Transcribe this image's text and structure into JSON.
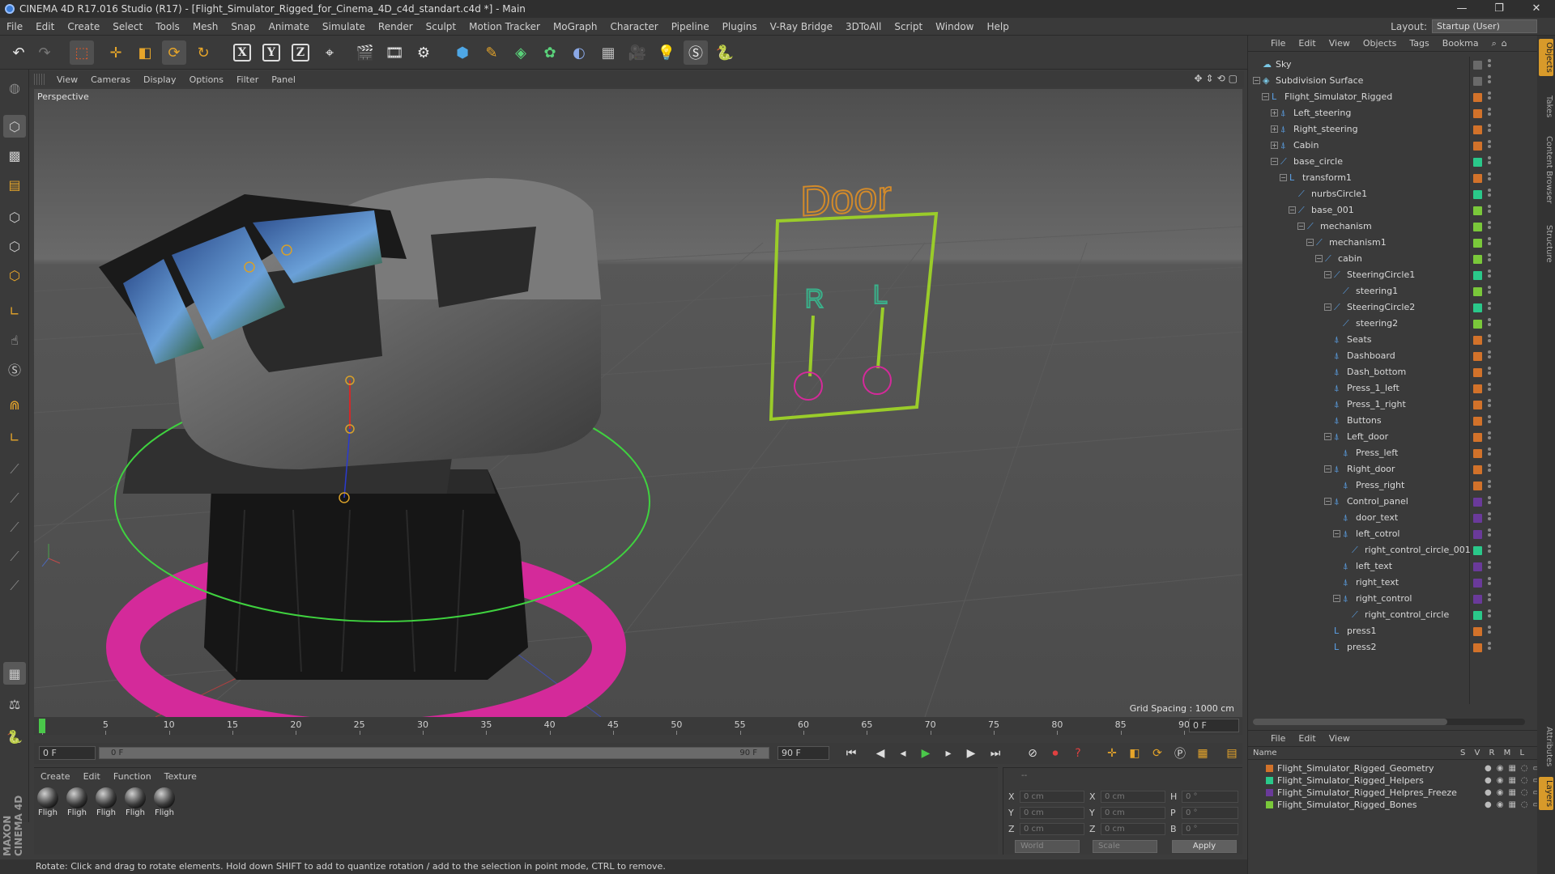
{
  "window": {
    "title": "CINEMA 4D R17.016 Studio (R17) - [Flight_Simulator_Rigged_for_Cinema_4D_c4d_standart.c4d *] - Main",
    "controls": [
      "—",
      "❐",
      "✕"
    ]
  },
  "menubar": {
    "items": [
      "File",
      "Edit",
      "Create",
      "Select",
      "Tools",
      "Mesh",
      "Snap",
      "Animate",
      "Simulate",
      "Render",
      "Sculpt",
      "Motion Tracker",
      "MoGraph",
      "Character",
      "Pipeline",
      "Plugins",
      "V-Ray Bridge",
      "3DToAll",
      "Script",
      "Window",
      "Help"
    ],
    "layout_label": "Layout:",
    "layout_value": "Startup (User)"
  },
  "toolbar": {
    "icons": [
      "undo-icon",
      "redo-icon",
      "live-selection-icon",
      "move-icon",
      "scale-icon",
      "rotate-icon",
      "recent-tool-icon",
      "x-axis-icon",
      "y-axis-icon",
      "z-axis-icon",
      "world-coordinate-icon",
      "render-view-icon",
      "render-picture-viewer-icon",
      "edit-render-settings-icon",
      "cube-icon",
      "pen-icon",
      "subdivision-icon",
      "cloner-icon",
      "deformer-icon",
      "floor-icon",
      "camera-icon",
      "light-icon",
      "python-generator-icon",
      "python-icon"
    ],
    "axis_labels": [
      "X",
      "Y",
      "Z"
    ]
  },
  "left_tools": [
    "make-editable-icon",
    "model-mode-icon",
    "texture-mode-icon",
    "workplane-icon",
    "points-mode-icon",
    "edges-mode-icon",
    "polygons-mode-icon",
    "axis-mode-icon",
    "tweak-icon",
    "solo-icon",
    "enable-snap-icon",
    "locked-workplane-icon",
    "planar-workplane-icon",
    "x-workplane-icon",
    "y-workplane-icon",
    "z-workplane-icon",
    "axis-workplane-icon",
    "viewport-solo-icon",
    "weight-icon",
    "python-icon"
  ],
  "viewport": {
    "menu": [
      "View",
      "Cameras",
      "Display",
      "Options",
      "Filter",
      "Panel"
    ],
    "label": "Perspective",
    "grid_spacing": "Grid Spacing : 1000 cm",
    "door_panel": {
      "title": "Door",
      "left_letter": "R",
      "right_letter": "L"
    },
    "colors": {
      "background": "#5a5a5a",
      "floor": "#4d4d4d",
      "green_ring": "#3fd23f",
      "pink_ring": "#d42a9a",
      "panel_frame": "#9acc2a",
      "door_text": "#d28a2a",
      "control_green": "#3ab08a"
    }
  },
  "timeline": {
    "ticks": [
      "0",
      "5",
      "10",
      "15",
      "20",
      "25",
      "30",
      "35",
      "40",
      "45",
      "50",
      "55",
      "60",
      "65",
      "70",
      "75",
      "80",
      "85",
      "90"
    ],
    "current_frame": "0 F"
  },
  "transport": {
    "start_field": "0 F",
    "slider_left": "0 F",
    "slider_right": "90 F",
    "end_field": "90 F"
  },
  "material_panel": {
    "menu": [
      "Create",
      "Edit",
      "Function",
      "Texture"
    ],
    "materials": [
      "Fligh",
      "Fligh",
      "Fligh",
      "Fligh",
      "Fligh"
    ]
  },
  "coordinates": {
    "header": "--",
    "rows": [
      {
        "a": "X",
        "av": "0 cm",
        "b": "X",
        "bv": "0 cm",
        "c": "H",
        "cv": "0 °"
      },
      {
        "a": "Y",
        "av": "0 cm",
        "b": "Y",
        "bv": "0 cm",
        "c": "P",
        "cv": "0 °"
      },
      {
        "a": "Z",
        "av": "0 cm",
        "b": "Z",
        "bv": "0 cm",
        "c": "B",
        "cv": "0 °"
      }
    ],
    "mode1": "World",
    "mode2": "Scale",
    "apply": "Apply"
  },
  "status": "Rotate: Click and drag to rotate elements. Hold down SHIFT to add to quantize rotation / add to the selection in point mode, CTRL to remove.",
  "maxon": "MAXON CINEMA 4D",
  "object_manager": {
    "menu": [
      "File",
      "Edit",
      "View",
      "Objects",
      "Tags",
      "Bookma"
    ],
    "objects": [
      {
        "name": "Sky",
        "depth": 0,
        "color": "#6a6a6a",
        "tree": ""
      },
      {
        "name": "Subdivision Surface",
        "depth": 0,
        "color": "#6a6a6a",
        "tree": "-"
      },
      {
        "name": "Flight_Simulator_Rigged",
        "depth": 1,
        "color": "#d2722a",
        "tree": "-"
      },
      {
        "name": "Left_steering",
        "depth": 2,
        "color": "#d2722a",
        "tree": "+"
      },
      {
        "name": "Right_steering",
        "depth": 2,
        "color": "#d2722a",
        "tree": "+"
      },
      {
        "name": "Cabin",
        "depth": 2,
        "color": "#d2722a",
        "tree": "+"
      },
      {
        "name": "base_circle",
        "depth": 2,
        "color": "#2ac88a",
        "tree": "-"
      },
      {
        "name": "transform1",
        "depth": 3,
        "color": "#d2722a",
        "tree": "-"
      },
      {
        "name": "nurbsCircle1",
        "depth": 4,
        "color": "#2ac88a",
        "tree": ""
      },
      {
        "name": "base_001",
        "depth": 4,
        "color": "#7ac83a",
        "tree": "-"
      },
      {
        "name": "mechanism",
        "depth": 5,
        "color": "#7ac83a",
        "tree": "-"
      },
      {
        "name": "mechanism1",
        "depth": 6,
        "color": "#7ac83a",
        "tree": "-"
      },
      {
        "name": "cabin",
        "depth": 7,
        "color": "#7ac83a",
        "tree": "-"
      },
      {
        "name": "SteeringCircle1",
        "depth": 8,
        "color": "#2ac88a",
        "tree": "-"
      },
      {
        "name": "steering1",
        "depth": 9,
        "color": "#7ac83a",
        "tree": ""
      },
      {
        "name": "SteeringCircle2",
        "depth": 8,
        "color": "#2ac88a",
        "tree": "-"
      },
      {
        "name": "steering2",
        "depth": 9,
        "color": "#7ac83a",
        "tree": ""
      },
      {
        "name": "Seats",
        "depth": 8,
        "color": "#d2722a",
        "tree": ""
      },
      {
        "name": "Dashboard",
        "depth": 8,
        "color": "#d2722a",
        "tree": ""
      },
      {
        "name": "Dash_bottom",
        "depth": 8,
        "color": "#d2722a",
        "tree": ""
      },
      {
        "name": "Press_1_left",
        "depth": 8,
        "color": "#d2722a",
        "tree": ""
      },
      {
        "name": "Press_1_right",
        "depth": 8,
        "color": "#d2722a",
        "tree": ""
      },
      {
        "name": "Buttons",
        "depth": 8,
        "color": "#d2722a",
        "tree": ""
      },
      {
        "name": "Left_door",
        "depth": 8,
        "color": "#d2722a",
        "tree": "-"
      },
      {
        "name": "Press_left",
        "depth": 9,
        "color": "#d2722a",
        "tree": ""
      },
      {
        "name": "Right_door",
        "depth": 8,
        "color": "#d2722a",
        "tree": "-"
      },
      {
        "name": "Press_right",
        "depth": 9,
        "color": "#d2722a",
        "tree": ""
      },
      {
        "name": "Control_panel",
        "depth": 8,
        "color": "#6a3a9a",
        "tree": "-"
      },
      {
        "name": "door_text",
        "depth": 9,
        "color": "#6a3a9a",
        "tree": ""
      },
      {
        "name": "left_cotrol",
        "depth": 9,
        "color": "#6a3a9a",
        "tree": "-"
      },
      {
        "name": "right_control_circle_001",
        "depth": 10,
        "color": "#2ac88a",
        "tree": ""
      },
      {
        "name": "left_text",
        "depth": 9,
        "color": "#6a3a9a",
        "tree": ""
      },
      {
        "name": "right_text",
        "depth": 9,
        "color": "#6a3a9a",
        "tree": ""
      },
      {
        "name": "right_control",
        "depth": 9,
        "color": "#6a3a9a",
        "tree": "-"
      },
      {
        "name": "right_control_circle",
        "depth": 10,
        "color": "#2ac88a",
        "tree": ""
      },
      {
        "name": "press1",
        "depth": 8,
        "color": "#d2722a",
        "tree": ""
      },
      {
        "name": "press2",
        "depth": 8,
        "color": "#d2722a",
        "tree": ""
      }
    ]
  },
  "layer_manager": {
    "menu": [
      "File",
      "Edit",
      "View"
    ],
    "header_name": "Name",
    "header_flags": "S V R M L",
    "layers": [
      {
        "name": "Flight_Simulator_Rigged_Geometry",
        "color": "#d2722a"
      },
      {
        "name": "Flight_Simulator_Rigged_Helpers",
        "color": "#2ac88a"
      },
      {
        "name": "Flight_Simulator_Rigged_Helpres_Freeze",
        "color": "#6a3a9a"
      },
      {
        "name": "Flight_Simulator_Rigged_Bones",
        "color": "#7ac83a"
      }
    ]
  },
  "side_tabs": [
    "Objects",
    "Takes",
    "Content Browser",
    "Structure",
    "Attributes",
    "Layers"
  ]
}
